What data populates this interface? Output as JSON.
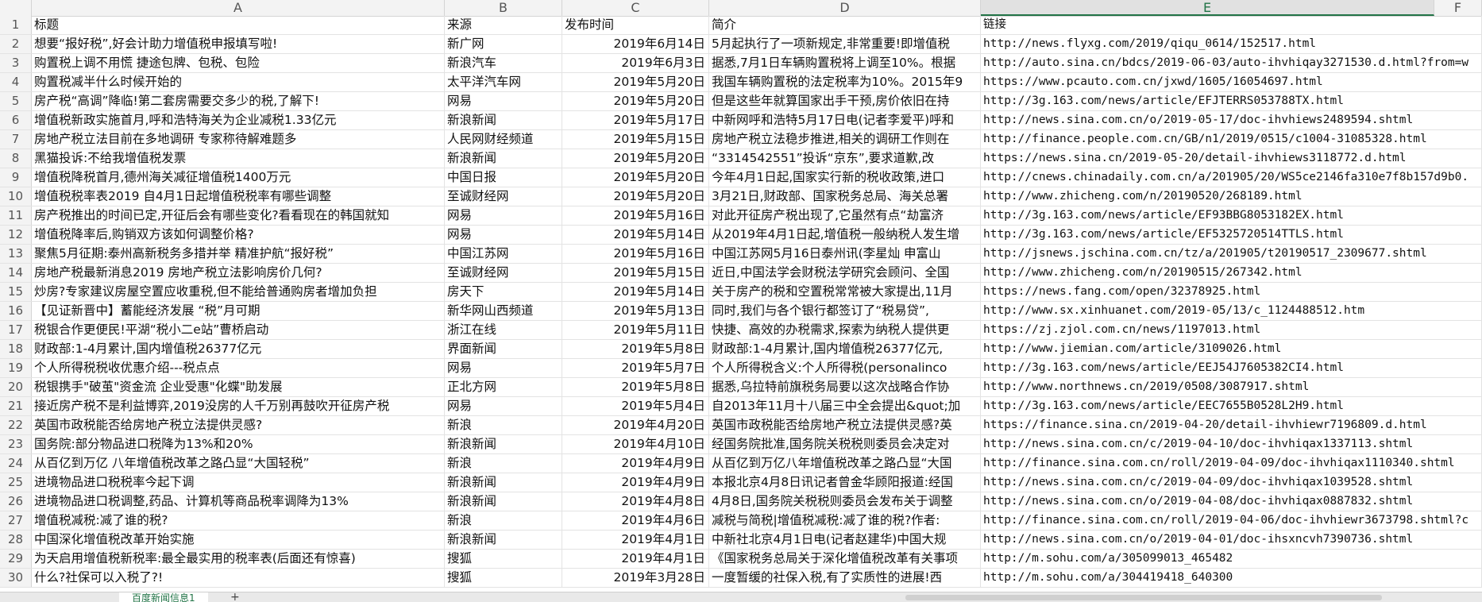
{
  "columns": [
    "A",
    "B",
    "C",
    "D",
    "E",
    "F"
  ],
  "selected_column": "E",
  "header_row": {
    "num": "1",
    "title": "标题",
    "source": "来源",
    "date": "发布时间",
    "summary": "简介",
    "link": "链接"
  },
  "rows": [
    {
      "num": "2",
      "title": "想要“报好税”,好会计助力增值税申报填写啦!",
      "source": "新广网",
      "date": "2019年6月14日",
      "summary": "5月起执行了一项新规定,非常重要!即增值税",
      "link": "http://news.flyxg.com/2019/qiqu_0614/152517.html"
    },
    {
      "num": "3",
      "title": "购置税上调不用慌 捷途包牌、包税、包险",
      "source": "新浪汽车",
      "date": "2019年6月3日",
      "summary": "据悉,7月1日车辆购置税将上调至10%。根据",
      "link": "http://auto.sina.cn/bdcs/2019-06-03/auto-ihvhiqay3271530.d.html?from=w"
    },
    {
      "num": "4",
      "title": "购置税减半什么时候开始的",
      "source": "太平洋汽车网",
      "date": "2019年5月20日",
      "summary": "我国车辆购置税的法定税率为10%。2015年9",
      "link": "https://www.pcauto.com.cn/jxwd/1605/16054697.html"
    },
    {
      "num": "5",
      "title": "房产税“高调”降临!第二套房需要交多少的税,了解下!",
      "source": "网易",
      "date": "2019年5月20日",
      "summary": "但是这些年就算国家出手干预,房价依旧在持",
      "link": "http://3g.163.com/news/article/EFJTERRS053788TX.html"
    },
    {
      "num": "6",
      "title": "增值税新政实施首月,呼和浩特海关为企业减税1.33亿元",
      "source": "新浪新闻",
      "date": "2019年5月17日",
      "summary": "中新网呼和浩特5月17日电(记者李爱平)呼和",
      "link": "http://news.sina.com.cn/o/2019-05-17/doc-ihvhiews2489594.shtml"
    },
    {
      "num": "7",
      "title": "房地产税立法目前在多地调研 专家称待解难题多",
      "source": "人民网财经频道",
      "date": "2019年5月15日",
      "summary": "房地产税立法稳步推进,相关的调研工作则在",
      "link": "http://finance.people.com.cn/GB/n1/2019/0515/c1004-31085328.html"
    },
    {
      "num": "8",
      "title": "黑猫投诉:不给我增值税发票",
      "source": "新浪新闻",
      "date": "2019年5月20日",
      "summary": "“3314542551”投诉“京东”,要求道歉,改",
      "link": "https://news.sina.cn/2019-05-20/detail-ihvhiews3118772.d.html"
    },
    {
      "num": "9",
      "title": "增值税降税首月,德州海关减征增值税1400万元",
      "source": "中国日报",
      "date": "2019年5月20日",
      "summary": "今年4月1日起,国家实行新的税收政策,进口",
      "link": "http://cnews.chinadaily.com.cn/a/201905/20/WS5ce2146fa310e7f8b157d9b0."
    },
    {
      "num": "10",
      "title": "增值税税率表2019 自4月1日起增值税税率有哪些调整",
      "source": "至诚财经网",
      "date": "2019年5月20日",
      "summary": "3月21日,财政部、国家税务总局、海关总署",
      "link": "http://www.zhicheng.com/n/20190520/268189.html"
    },
    {
      "num": "11",
      "title": "房产税推出的时间已定,开征后会有哪些变化?看看现在的韩国就知",
      "source": "网易",
      "date": "2019年5月16日",
      "summary": "对此开征房产税出现了,它虽然有点“劫富济",
      "link": "http://3g.163.com/news/article/EF93BBG8053182EX.html"
    },
    {
      "num": "12",
      "title": "增值税降率后,购销双方该如何调整价格?",
      "source": "网易",
      "date": "2019年5月14日",
      "summary": "从2019年4月1日起,增值税一般纳税人发生增",
      "link": "http://3g.163.com/news/article/EF5325720514TTLS.html"
    },
    {
      "num": "13",
      "title": "聚焦5月征期:泰州高新税务多措并举 精准护航“报好税”",
      "source": "中国江苏网",
      "date": "2019年5月16日",
      "summary": "中国江苏网5月16日泰州讯(李星灿 申富山",
      "link": "http://jsnews.jschina.com.cn/tz/a/201905/t20190517_2309677.shtml"
    },
    {
      "num": "14",
      "title": "房地产税最新消息2019 房地产税立法影响房价几何?",
      "source": "至诚财经网",
      "date": "2019年5月15日",
      "summary": "近日,中国法学会财税法学研究会顾问、全国",
      "link": "http://www.zhicheng.com/n/20190515/267342.html"
    },
    {
      "num": "15",
      "title": "炒房?专家建议房屋空置应收重税,但不能给普通购房者增加负担",
      "source": "房天下",
      "date": "2019年5月14日",
      "summary": "关于房产的税和空置税常常被大家提出,11月",
      "link": "https://news.fang.com/open/32378925.html"
    },
    {
      "num": "16",
      "title": "【见证新晋中】蓄能经济发展 “税”月可期",
      "source": "新华网山西频道",
      "date": "2019年5月13日",
      "summary": "同时,我们与各个银行都签订了“税易贷”,",
      "link": "http://www.sx.xinhuanet.com/2019-05/13/c_1124488512.htm"
    },
    {
      "num": "17",
      "title": "税银合作更便民!平湖“税小二e站”曹桥启动",
      "source": "浙江在线",
      "date": "2019年5月11日",
      "summary": "快捷、高效的办税需求,探索为纳税人提供更",
      "link": "https://zj.zjol.com.cn/news/1197013.html"
    },
    {
      "num": "18",
      "title": "财政部:1-4月累计,国内增值税26377亿元",
      "source": "界面新闻",
      "date": "2019年5月8日",
      "summary": "财政部:1-4月累计,国内增值税26377亿元,",
      "link": "http://www.jiemian.com/article/3109026.html"
    },
    {
      "num": "19",
      "title": "个人所得税税收优惠介绍---税点点",
      "source": "网易",
      "date": "2019年5月7日",
      "summary": "个人所得税含义:个人所得税(personalinco",
      "link": "http://3g.163.com/news/article/EEJ54J7605382CI4.html"
    },
    {
      "num": "20",
      "title": "税银携手\"破茧\"资金流 企业受惠\"化蝶\"助发展",
      "source": "正北方网",
      "date": "2019年5月8日",
      "summary": "据悉,乌拉特前旗税务局要以这次战略合作协",
      "link": "http://www.northnews.cn/2019/0508/3087917.shtml"
    },
    {
      "num": "21",
      "title": "接近房产税不是利益博弈,2019没房的人千万别再鼓吹开征房产税",
      "source": "网易",
      "date": "2019年5月4日",
      "summary": "自2013年11月十八届三中全会提出&quot;加",
      "link": "http://3g.163.com/news/article/EEC7655B0528L2H9.html"
    },
    {
      "num": "22",
      "title": "英国市政税能否给房地产税立法提供灵感?",
      "source": "新浪",
      "date": "2019年4月20日",
      "summary": "英国市政税能否给房地产税立法提供灵感?英",
      "link": "https://finance.sina.cn/2019-04-20/detail-ihvhiewr7196809.d.html"
    },
    {
      "num": "23",
      "title": "国务院:部分物品进口税降为13%和20%",
      "source": "新浪新闻",
      "date": "2019年4月10日",
      "summary": "经国务院批准,国务院关税税则委员会决定对",
      "link": "http://news.sina.com.cn/c/2019-04-10/doc-ihvhiqax1337113.shtml"
    },
    {
      "num": "24",
      "title": "从百亿到万亿 八年增值税改革之路凸显“大国轻税”",
      "source": "新浪",
      "date": "2019年4月9日",
      "summary": "从百亿到万亿八年增值税改革之路凸显“大国",
      "link": "http://finance.sina.com.cn/roll/2019-04-09/doc-ihvhiqax1110340.shtml"
    },
    {
      "num": "25",
      "title": "进境物品进口税税率今起下调",
      "source": "新浪新闻",
      "date": "2019年4月9日",
      "summary": "本报北京4月8日讯记者曾金华顾阳报道:经国",
      "link": "http://news.sina.com.cn/c/2019-04-09/doc-ihvhiqax1039528.shtml"
    },
    {
      "num": "26",
      "title": "进境物品进口税调整,药品、计算机等商品税率调降为13%",
      "source": "新浪新闻",
      "date": "2019年4月8日",
      "summary": "4月8日,国务院关税税则委员会发布关于调整",
      "link": "http://news.sina.com.cn/o/2019-04-08/doc-ihvhiqax0887832.shtml"
    },
    {
      "num": "27",
      "title": "增值税减税:减了谁的税?",
      "source": "新浪",
      "date": "2019年4月6日",
      "summary": "减税与简税|增值税减税:减了谁的税?作者:",
      "link": "http://finance.sina.com.cn/roll/2019-04-06/doc-ihvhiewr3673798.shtml?c"
    },
    {
      "num": "28",
      "title": "中国深化增值税改革开始实施",
      "source": "新浪新闻",
      "date": "2019年4月1日",
      "summary": "中新社北京4月1日电(记者赵建华)中国大规",
      "link": "http://news.sina.com.cn/o/2019-04-01/doc-ihsxncvh7390736.shtml"
    },
    {
      "num": "29",
      "title": "为天启用增值税新税率:最全最实用的税率表(后面还有惊喜)",
      "source": "搜狐",
      "date": "2019年4月1日",
      "summary": "《国家税务总局关于深化增值税改革有关事项",
      "link": "http://m.sohu.com/a/305099013_465482"
    },
    {
      "num": "30",
      "title": "什么?社保可以入税了?!",
      "source": "搜狐",
      "date": "2019年3月28日",
      "summary": "一度暂缓的社保入税,有了实质性的进展!西",
      "link": "http://m.sohu.com/a/304419418_640300"
    }
  ],
  "sheet_tab": "百度新闻信息1",
  "add_sheet_label": "+"
}
